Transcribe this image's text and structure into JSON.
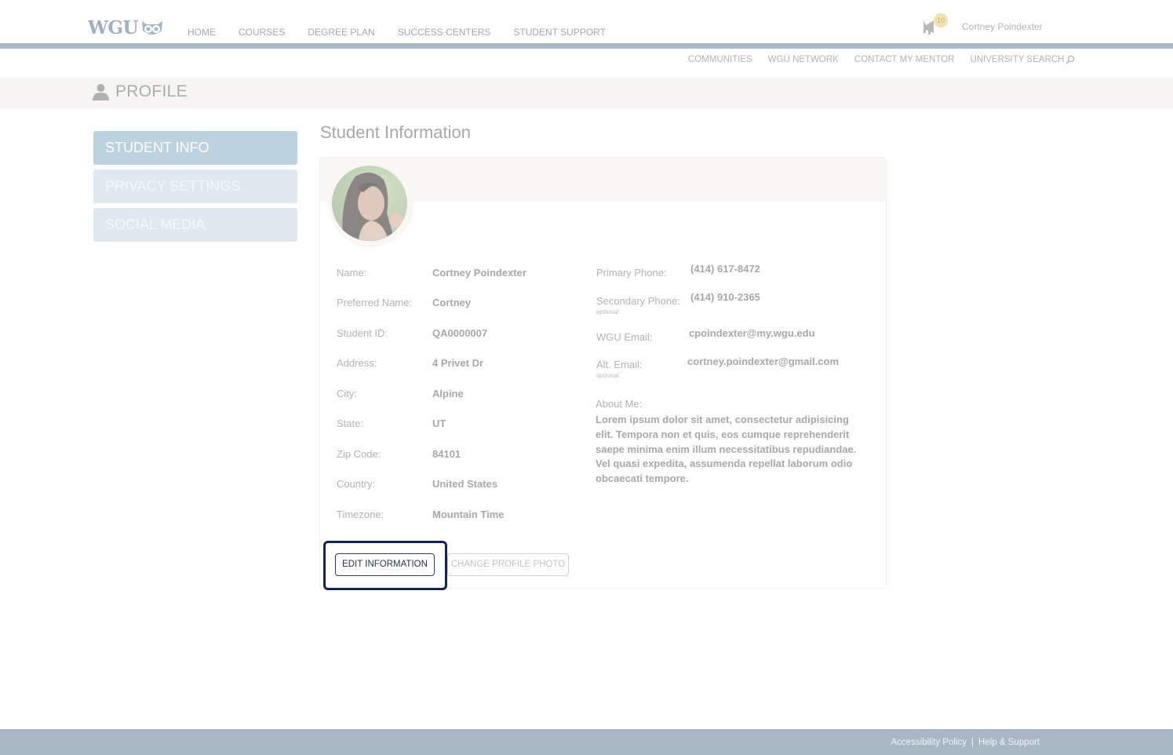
{
  "header": {
    "logo_text": "WGU",
    "nav": [
      "HOME",
      "COURSES",
      "DEGREE PLAN",
      "SUCCESS CENTERS",
      "STUDENT SUPPORT"
    ],
    "notification_count": "10",
    "user_name": "Cortney Poindexter"
  },
  "sub_nav": {
    "links": [
      "COMMUNITIES",
      "WGU NETWORK",
      "CONTACT MY MENTOR",
      "UNIVERSITY SEARCH"
    ]
  },
  "page": {
    "title": "PROFILE"
  },
  "sidebar": {
    "items": [
      {
        "label": "STUDENT INFO",
        "active": true
      },
      {
        "label": "PRIVACY SETTINGS",
        "active": false
      },
      {
        "label": "SOCIAL MEDIA",
        "active": false
      }
    ]
  },
  "main": {
    "section_title": "Student Information",
    "left_fields": [
      {
        "label": "Name:",
        "value": "Cortney Poindexter"
      },
      {
        "label": "Preferred Name:",
        "value": "Cortney"
      },
      {
        "label": "Student ID:",
        "value": "QA0000007"
      },
      {
        "label": "Address:",
        "value": "4 Privet Dr"
      },
      {
        "label": "City:",
        "value": "Alpine"
      },
      {
        "label": "State:",
        "value": "UT"
      },
      {
        "label": "Zip Code:",
        "value": "84101"
      },
      {
        "label": "Country:",
        "value": "United States"
      },
      {
        "label": "Timezone:",
        "value": "Mountain Time"
      }
    ],
    "right_fields": [
      {
        "label": "Primary Phone:",
        "value": "(414) 617-8472"
      },
      {
        "label": "Secondary Phone:",
        "value": "(414) 910-2365",
        "note": "optional"
      },
      {
        "label": "WGU Email:",
        "value": "cpoindexter@my.wgu.edu"
      },
      {
        "label": "Alt. Email:",
        "value": "cortney.poindexter@gmail.com",
        "note": "optional"
      }
    ],
    "about_label": "About Me:",
    "about_text": "Lorem ipsum dolor sit amet, consectetur adipisicing elit. Tempora non et quis, eos cumque reprehenderit saepe minima enim illum necessitatibus repudiandae. Vel quasi expedita, assumenda repellat laborum odio obcaecati tempore.",
    "buttons": {
      "edit": "EDIT INFORMATION",
      "change_photo": "CHANGE PROFILE PHOTO"
    }
  },
  "footer": {
    "links": [
      "Accessibility Policy",
      "Help & Support"
    ],
    "separator": "|"
  },
  "colors": {
    "brand_blue": "#a9b9c7",
    "active_tab": "#bcd2df",
    "focus_ring": "#0f2557"
  }
}
